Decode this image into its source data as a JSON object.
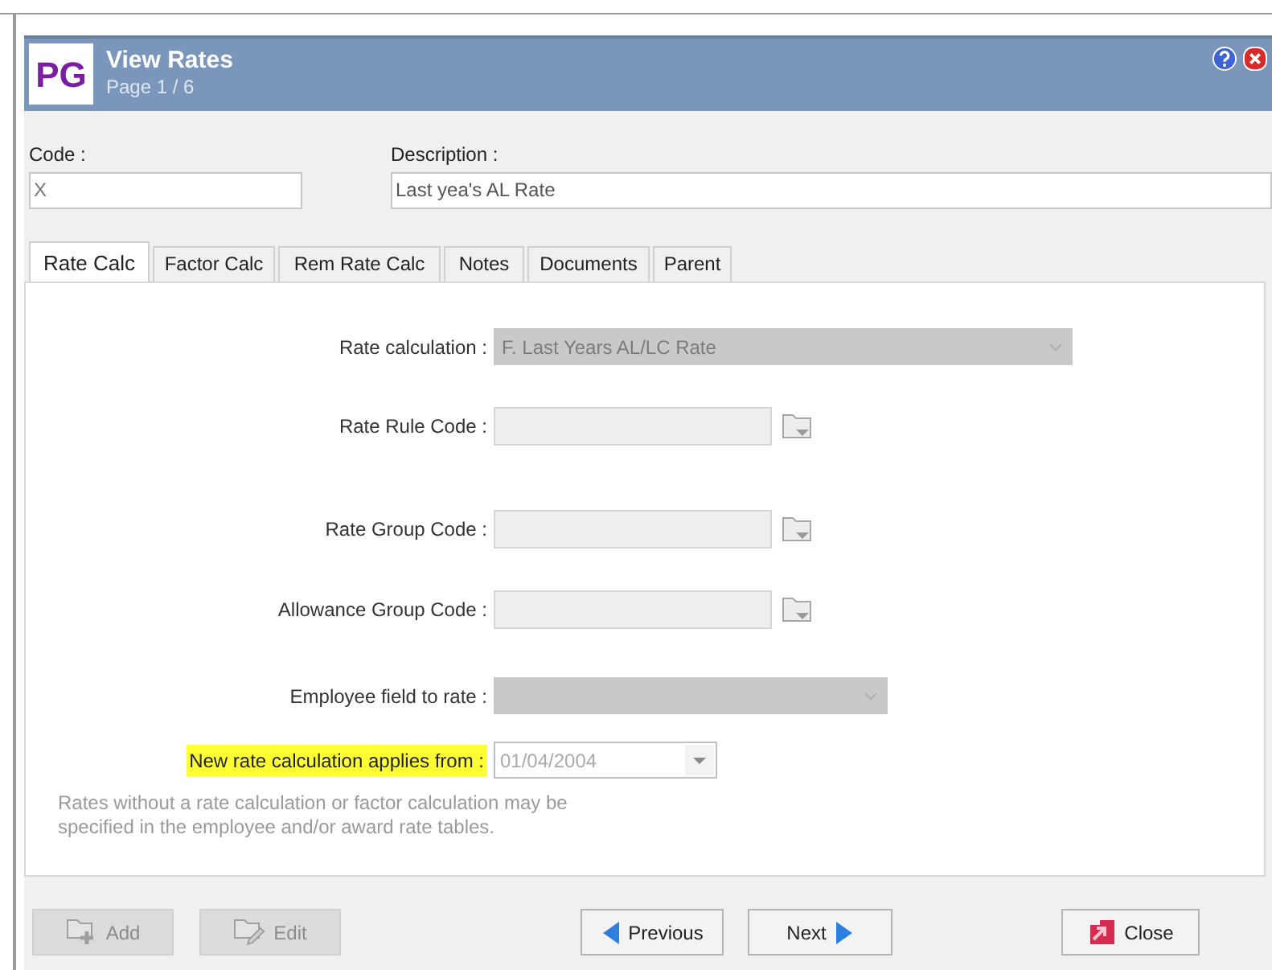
{
  "header": {
    "logo": "PG",
    "title": "View Rates",
    "subtitle": "Page 1 / 6"
  },
  "code": {
    "label": "Code :",
    "value": "X"
  },
  "description": {
    "label": "Description :",
    "value": "Last yea's AL Rate"
  },
  "tabs": [
    {
      "label": "Rate Calc",
      "selected": true
    },
    {
      "label": "Factor Calc",
      "selected": false
    },
    {
      "label": "Rem Rate Calc",
      "selected": false
    },
    {
      "label": "Notes",
      "selected": false
    },
    {
      "label": "Documents",
      "selected": false
    },
    {
      "label": "Parent",
      "selected": false
    }
  ],
  "fields": [
    {
      "kind": "combo",
      "label": "Rate calculation :",
      "value": "F. Last Years AL/LC Rate",
      "highlighted": false
    },
    {
      "kind": "lookup",
      "label": "Rate Rule Code :",
      "highlighted": false
    },
    {
      "kind": "lookup",
      "label": "Rate Group Code :",
      "highlighted": false
    },
    {
      "kind": "lookup",
      "label": "Allowance Group Code :",
      "highlighted": false
    },
    {
      "kind": "combo-wide",
      "label": "Employee field to rate :",
      "highlighted": false
    },
    {
      "kind": "date",
      "label": "New rate calculation applies from :",
      "value": "01/04/2004",
      "highlighted": true
    }
  ],
  "note": "Rates without a rate calculation or factor calculation may be specified in the employee and/or award rate tables.",
  "buttons": [
    {
      "kind": "add",
      "label": "Add",
      "disabled": true
    },
    {
      "kind": "edit",
      "label": "Edit",
      "disabled": true
    },
    {
      "kind": "previous",
      "label": "Previous",
      "disabled": false
    },
    {
      "kind": "next",
      "label": "Next",
      "disabled": false
    },
    {
      "kind": "close",
      "label": "Close",
      "disabled": false
    }
  ]
}
